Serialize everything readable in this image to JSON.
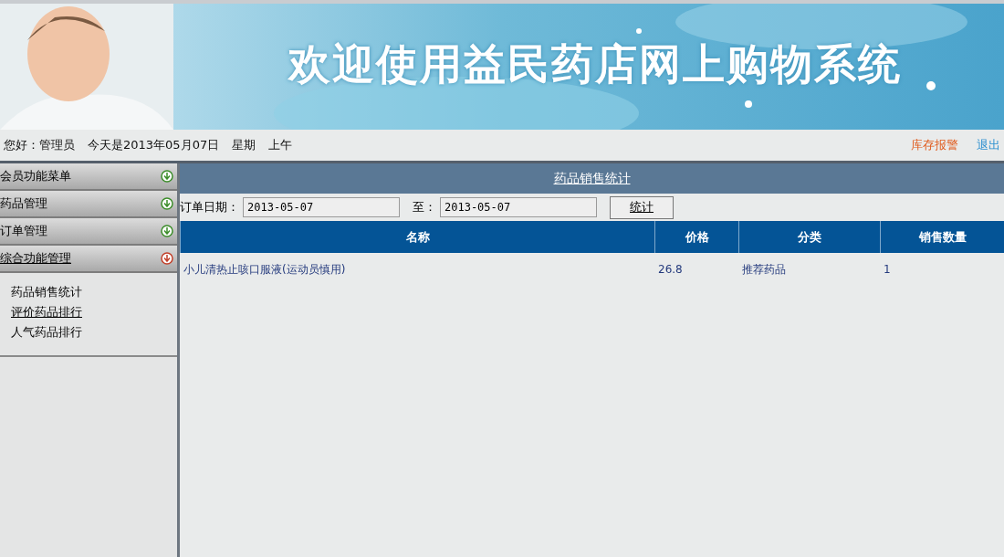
{
  "banner": {
    "title": "欢迎使用益民药店网上购物系统",
    "kind": "picture"
  },
  "info_bar": {
    "greeting": "您好：管理员",
    "date": "今天是2013年05月07日",
    "weekday": "星期",
    "period": "上午",
    "links": [
      "库存报警",
      "退出"
    ]
  },
  "sidebar": {
    "menus": [
      {
        "label": "会员功能菜单",
        "expanded": false
      },
      {
        "label": "药品管理",
        "expanded": false
      },
      {
        "label": "订单管理",
        "expanded": false
      },
      {
        "label": "综合功能管理",
        "expanded": true,
        "children": [
          {
            "label": "药品销售统计",
            "selected": false
          },
          {
            "label": "评价药品排行",
            "selected": true
          },
          {
            "label": "人气药品排行",
            "selected": false
          }
        ]
      }
    ]
  },
  "panel": {
    "title": "药品销售统计",
    "filter": {
      "label": "订单日期：",
      "from": "2013-05-07",
      "to_label": "至：",
      "to": "2013-05-07",
      "button": "统计"
    },
    "table": {
      "columns": [
        "名称",
        "价格",
        "分类",
        "销售数量"
      ],
      "rows": [
        [
          "小儿清热止咳口服液(运动员慎用)",
          "26.8",
          "推荐药品",
          "1"
        ]
      ]
    }
  }
}
